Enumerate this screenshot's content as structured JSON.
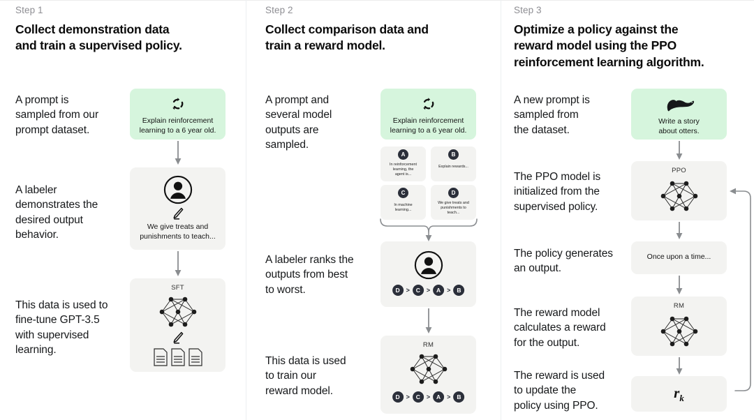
{
  "steps": [
    {
      "label": "Step 1",
      "title_line1": "Collect demonstration data",
      "title_line2": "and train a supervised policy.",
      "descriptions": [
        "A prompt is\nsampled from our\nprompt dataset.",
        "A labeler\ndemonstrates the\ndesired output\nbehavior.",
        "This data is used to\nfine-tune GPT-3.5\nwith supervised\nlearning."
      ],
      "prompt_card": {
        "text": "Explain reinforcement\nlearning to a 6 year old.",
        "icon": "refresh-cycle-icon",
        "color": "#d6f5dd"
      },
      "labeler_card": {
        "text": "We give treats and\npunishments to teach...",
        "icon": "labeler-person-icon",
        "secondary_icon": "pencil-icon"
      },
      "model_card": {
        "title": "SFT",
        "icon": "neural-network-icon",
        "secondary_icon": "pencil-icon",
        "tertiary_icon": "documents-icon"
      }
    },
    {
      "label": "Step 2",
      "title_line1": "Collect comparison data and",
      "title_line2": "train a reward model.",
      "descriptions": [
        "A prompt and\nseveral model\noutputs are\nsampled.",
        "A labeler ranks the\noutputs from best\nto worst.",
        "This data is used\nto train our\nreward model."
      ],
      "prompt_card": {
        "text": "Explain reinforcement\nlearning to a 6 year old.",
        "icon": "refresh-cycle-icon",
        "color": "#d6f5dd"
      },
      "outputs": [
        {
          "letter": "A",
          "text": "In reinforcement\nlearning, the\nagent is..."
        },
        {
          "letter": "B",
          "text": "Explain rewards..."
        },
        {
          "letter": "C",
          "text": "In machine\nlearning..."
        },
        {
          "letter": "D",
          "text": "We give treats and\npunishments to\nteach..."
        }
      ],
      "ranking_card": {
        "icon": "labeler-person-icon",
        "ranking": [
          "D",
          "C",
          "A",
          "B"
        ],
        "separator": ">"
      },
      "reward_model_card": {
        "title": "RM",
        "icon": "neural-network-icon",
        "ranking": [
          "D",
          "C",
          "A",
          "B"
        ],
        "separator": ">"
      }
    },
    {
      "label": "Step 3",
      "title_line1": "Optimize a policy against the",
      "title_line2": "reward model using the PPO",
      "title_line3": "reinforcement learning algorithm.",
      "descriptions": [
        "A new prompt is\nsampled from\nthe dataset.",
        "The PPO model is\ninitialized from the\nsupervised policy.",
        "The policy generates\nan output.",
        "The reward model\ncalculates a reward\nfor the output.",
        "The reward is used\nto update the\npolicy using PPO."
      ],
      "prompt_card": {
        "text": "Write a story\nabout otters.",
        "icon": "otter-icon",
        "color": "#d6f5dd"
      },
      "ppo_card": {
        "title": "PPO",
        "icon": "neural-network-icon"
      },
      "output_card": {
        "text": "Once upon a time..."
      },
      "rm_card": {
        "title": "RM",
        "icon": "neural-network-icon"
      },
      "reward_card": {
        "value": "r",
        "subscript": "k"
      }
    }
  ],
  "colors": {
    "card_gray": "#f3f3f1",
    "card_green": "#d6f5dd",
    "badge": "#2b2f3a",
    "arrow": "#8a8d90",
    "divider": "#eceff1",
    "step_label": "#8e8e93",
    "text": "#16181a"
  },
  "icons": {
    "arrow_down": "arrow-down-icon",
    "brace": "curly-brace-icon",
    "feedback_loop": "feedback-loop-arrow-icon"
  }
}
